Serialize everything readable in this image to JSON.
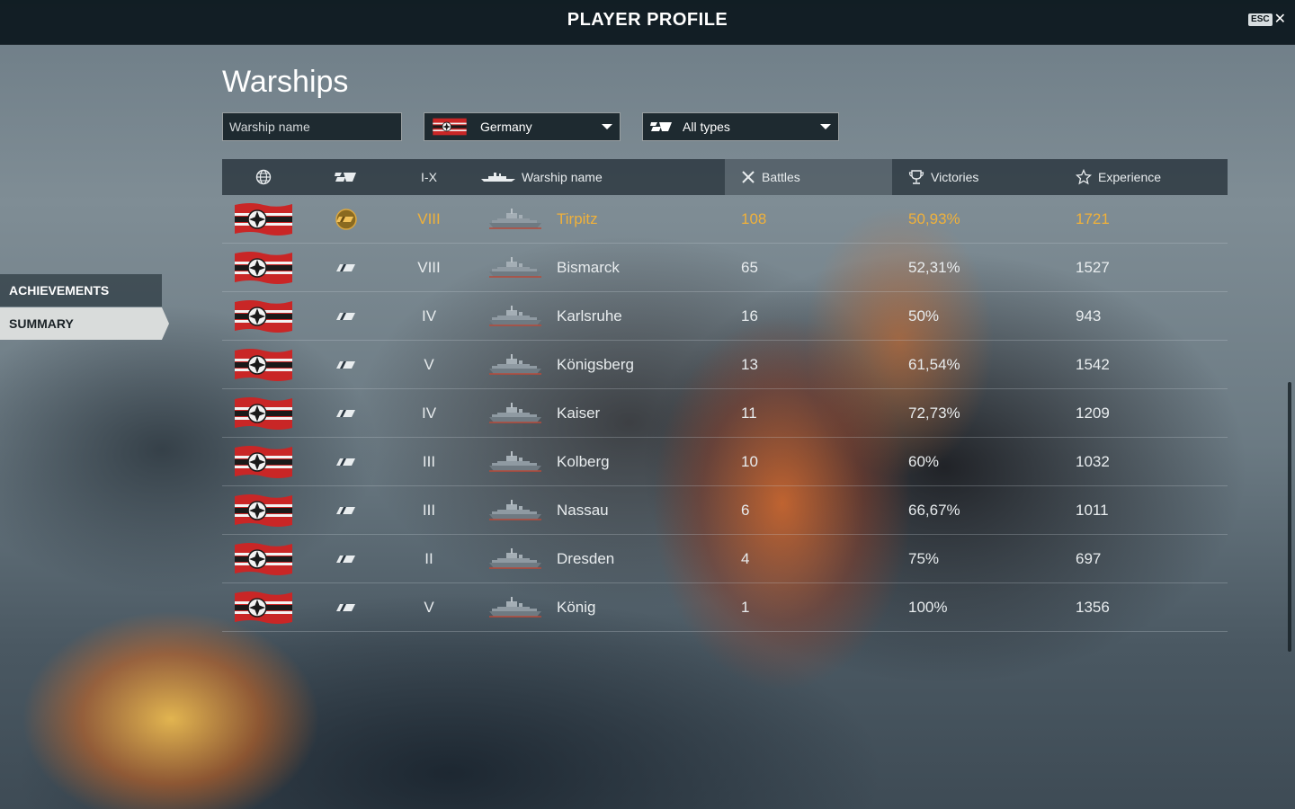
{
  "header": {
    "title": "PLAYER PROFILE",
    "esc_label": "ESC",
    "close_glyph": "✕"
  },
  "nav": {
    "items": [
      {
        "label": "ACHIEVEMENTS",
        "active": false
      },
      {
        "label": "SUMMARY",
        "active": true
      }
    ]
  },
  "main": {
    "title": "Warships",
    "search_placeholder": "Warship name",
    "nation_filter": "Germany",
    "type_filter": "All types"
  },
  "table": {
    "columns": {
      "nation_icon": "globe-icon",
      "type_icon": "ship-class-icon",
      "tier": "I-X",
      "name": "Warship name",
      "battles": "Battles",
      "victories": "Victories",
      "experience": "Experience"
    },
    "sorted_column": "battles",
    "rows": [
      {
        "tier": "VIII",
        "name": "Tirpitz",
        "battles": "108",
        "victories": "50,93%",
        "experience": "1721",
        "premium": true
      },
      {
        "tier": "VIII",
        "name": "Bismarck",
        "battles": "65",
        "victories": "52,31%",
        "experience": "1527",
        "premium": false
      },
      {
        "tier": "IV",
        "name": "Karlsruhe",
        "battles": "16",
        "victories": "50%",
        "experience": "943",
        "premium": false
      },
      {
        "tier": "V",
        "name": "Königsberg",
        "battles": "13",
        "victories": "61,54%",
        "experience": "1542",
        "premium": false
      },
      {
        "tier": "IV",
        "name": "Kaiser",
        "battles": "11",
        "victories": "72,73%",
        "experience": "1209",
        "premium": false
      },
      {
        "tier": "III",
        "name": "Kolberg",
        "battles": "10",
        "victories": "60%",
        "experience": "1032",
        "premium": false
      },
      {
        "tier": "III",
        "name": "Nassau",
        "battles": "6",
        "victories": "66,67%",
        "experience": "1011",
        "premium": false
      },
      {
        "tier": "II",
        "name": "Dresden",
        "battles": "4",
        "victories": "75%",
        "experience": "697",
        "premium": false
      },
      {
        "tier": "V",
        "name": "König",
        "battles": "1",
        "victories": "100%",
        "experience": "1356",
        "premium": false
      }
    ]
  },
  "colors": {
    "premium_text": "#f0b13a",
    "flag_red": "#d42a2a",
    "topbar_bg": "#0a161c"
  }
}
